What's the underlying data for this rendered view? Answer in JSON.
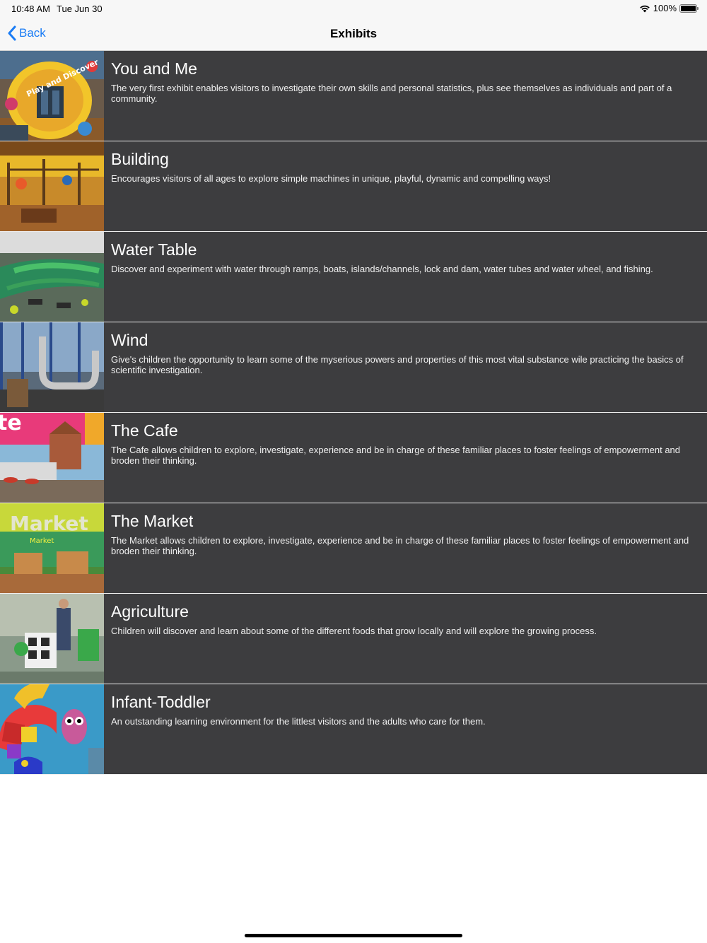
{
  "status": {
    "time": "10:48 AM",
    "date": "Tue Jun 30",
    "battery": "100%"
  },
  "nav": {
    "back_label": "Back",
    "title": "Exhibits"
  },
  "exhibits": [
    {
      "title": "You and Me",
      "description": "The very first exhibit enables visitors to investigate their own skills and personal statistics, plus see themselves as individuals and part of a community."
    },
    {
      "title": "Building",
      "description": "Encourages visitors of all ages to explore simple machines in unique, playful, dynamic and compelling ways!"
    },
    {
      "title": "Water Table",
      "description": "Discover and experiment with water through ramps, boats, islands/channels, lock and dam, water tubes and water wheel, and fishing."
    },
    {
      "title": "Wind",
      "description": "Give's children the opportunity to learn some of the myserious powers and properties of this most vital substance wile practicing the basics of scientific investigation."
    },
    {
      "title": "The Cafe",
      "description": "The Cafe allows children to explore, investigate, experience and be in charge of these familiar places to foster feelings of empowerment and broden their thinking."
    },
    {
      "title": "The Market",
      "description": "The Market allows children to explore, investigate, experience and be in charge of these familiar places to foster feelings of empowerment and broden their thinking."
    },
    {
      "title": "Agriculture",
      "description": "Children will discover and learn about some of the different foods that grow locally and will explore the growing process."
    },
    {
      "title": "Infant-Toddler",
      "description": "An outstanding learning environment for the littlest visitors and the adults who care for them."
    }
  ],
  "thumbnails": {
    "you_and_me_text": "Play and Discover",
    "cafe_text": "te",
    "market_text": "Market",
    "market_sub_text": "Market"
  },
  "colors": {
    "row_bg": "#3d3d3f",
    "accent": "#1a7cf5",
    "bar_bg": "#f7f7f7"
  }
}
